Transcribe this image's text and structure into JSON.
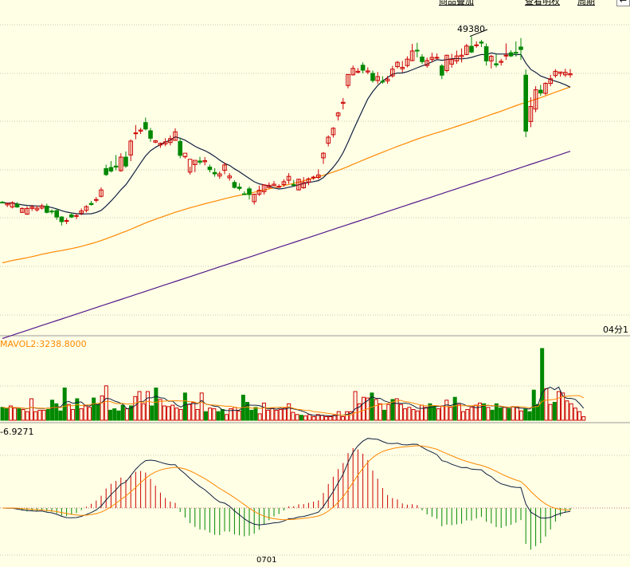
{
  "toolbar": {
    "links": [
      "商品叠加",
      "查看明权",
      "周期"
    ],
    "corner_button": "←"
  },
  "colors": {
    "background": "#ffffe6",
    "up": "#cc0000",
    "down": "#008800",
    "ma_fast": "#102040",
    "ma_mid": "#ff8800",
    "ma_slow": "#551a8b",
    "grid": "#c8c8b4"
  },
  "chart_data": [
    {
      "type": "candlestick",
      "title": "",
      "annotations": [
        {
          "text": "49380",
          "label": "high"
        }
      ],
      "time_label": "04分1",
      "y_min": 41000,
      "y_max": 50400,
      "candles": [
        [
          44725,
          44760,
          44715,
          44700
        ],
        [
          44650,
          44710,
          44690,
          44590
        ],
        [
          44590,
          44750,
          44710,
          44550
        ],
        [
          44665,
          44730,
          44590,
          44570
        ],
        [
          44440,
          44580,
          44550,
          44420
        ],
        [
          44390,
          44610,
          44550,
          44370
        ],
        [
          44550,
          44650,
          44590,
          44480
        ],
        [
          44510,
          44630,
          44560,
          44460
        ],
        [
          44560,
          44680,
          44620,
          44520
        ],
        [
          44615,
          44685,
          44440,
          44410
        ],
        [
          44475,
          44525,
          44470,
          44390
        ],
        [
          44490,
          44520,
          44310,
          44230
        ],
        [
          44310,
          44330,
          44180,
          44070
        ],
        [
          44190,
          44280,
          44210,
          44110
        ],
        [
          44370,
          44430,
          44310,
          44280
        ],
        [
          44335,
          44400,
          44350,
          44250
        ],
        [
          44420,
          44550,
          44480,
          44360
        ],
        [
          44495,
          44640,
          44600,
          44440
        ],
        [
          44690,
          44760,
          44660,
          44630
        ],
        [
          44780,
          44870,
          44800,
          44720
        ],
        [
          44890,
          45140,
          45070,
          44860
        ],
        [
          45670,
          45780,
          45500,
          45460
        ],
        [
          45700,
          45880,
          45600,
          45560
        ],
        [
          45740,
          46050,
          45710,
          45620
        ],
        [
          45610,
          46100,
          45990,
          45580
        ],
        [
          45990,
          46150,
          45740,
          45690
        ],
        [
          46050,
          46490,
          46440,
          45880
        ],
        [
          46660,
          46890,
          46670,
          46490
        ],
        [
          46720,
          46810,
          46750,
          46640
        ],
        [
          46960,
          47100,
          46780,
          46740
        ],
        [
          46730,
          46810,
          46520,
          46420
        ],
        [
          46410,
          46470,
          46450,
          46380
        ],
        [
          46330,
          46400,
          46380,
          46250
        ],
        [
          46360,
          46520,
          46420,
          46300
        ],
        [
          46400,
          46600,
          46510,
          46320
        ],
        [
          46460,
          46800,
          46700,
          46450
        ],
        [
          46430,
          46530,
          46040,
          45960
        ],
        [
          46000,
          46040,
          46100,
          45950
        ],
        [
          45570,
          45720,
          45930,
          45500
        ],
        [
          45780,
          45880,
          45900,
          45570
        ],
        [
          45880,
          46000,
          45850,
          45780
        ],
        [
          45860,
          45990,
          45890,
          45760
        ],
        [
          45710,
          45780,
          45640,
          45560
        ],
        [
          45560,
          45680,
          45520,
          45440
        ],
        [
          45460,
          45590,
          45520,
          45380
        ],
        [
          45620,
          45840,
          45770,
          45510
        ],
        [
          45410,
          45540,
          45460,
          45330
        ],
        [
          45280,
          45340,
          45140,
          45110
        ],
        [
          45150,
          45260,
          45110,
          45050
        ],
        [
          44960,
          45030,
          44950,
          44930
        ],
        [
          45100,
          45160,
          44940,
          44800
        ],
        [
          44740,
          44960,
          44950,
          44660
        ],
        [
          44950,
          45190,
          45060,
          44900
        ],
        [
          45020,
          45230,
          45210,
          44940
        ],
        [
          45140,
          45280,
          45200,
          45110
        ],
        [
          45190,
          45320,
          45230,
          45170
        ],
        [
          45160,
          45230,
          45170,
          45120
        ],
        [
          45220,
          45370,
          45300,
          45160
        ],
        [
          45340,
          45540,
          45450,
          45240
        ],
        [
          45220,
          45350,
          45210,
          45180
        ],
        [
          45070,
          45380,
          45370,
          45060
        ],
        [
          45130,
          45430,
          45280,
          45100
        ],
        [
          45290,
          45420,
          45380,
          45200
        ],
        [
          45410,
          45470,
          45430,
          45350
        ],
        [
          45420,
          45650,
          45490,
          45370
        ],
        [
          45970,
          46130,
          46100,
          45800
        ],
        [
          46380,
          46600,
          46550,
          46290
        ],
        [
          46620,
          46830,
          46800,
          46540
        ],
        [
          47150,
          47260,
          47230,
          47020
        ],
        [
          47500,
          47650,
          47530,
          47330
        ],
        [
          48000,
          48320,
          48310,
          47920
        ],
        [
          48300,
          48560,
          48480,
          48280
        ],
        [
          48370,
          48490,
          48400,
          48340
        ],
        [
          48570,
          48650,
          48430,
          48340
        ],
        [
          48380,
          48510,
          48410,
          48320
        ],
        [
          48340,
          48420,
          48140,
          48080
        ],
        [
          48140,
          48380,
          48250,
          48050
        ],
        [
          48120,
          48260,
          48100,
          48050
        ],
        [
          48130,
          48270,
          48180,
          48050
        ],
        [
          48270,
          48550,
          48460,
          48220
        ],
        [
          48530,
          48690,
          48650,
          48480
        ],
        [
          48470,
          48690,
          48510,
          48370
        ],
        [
          48560,
          48820,
          48740,
          48510
        ],
        [
          48700,
          49170,
          48970,
          48680
        ],
        [
          48990,
          49200,
          48980,
          48790
        ],
        [
          48800,
          48880,
          48670,
          48600
        ],
        [
          48560,
          48780,
          48700,
          48500
        ],
        [
          48730,
          48920,
          48790,
          48650
        ],
        [
          48780,
          48900,
          48790,
          48730
        ],
        [
          48550,
          48600,
          48290,
          48180
        ],
        [
          48420,
          48860,
          48850,
          48370
        ],
        [
          48600,
          48890,
          48730,
          48500
        ],
        [
          48690,
          48980,
          48830,
          48610
        ],
        [
          48810,
          49040,
          48850,
          48650
        ],
        [
          48870,
          49170,
          49110,
          48850
        ],
        [
          49100,
          49380,
          48940,
          48910
        ],
        [
          49120,
          49240,
          49140,
          49060
        ],
        [
          49220,
          49280,
          49190,
          49080
        ],
        [
          49090,
          49180,
          48690,
          48560
        ],
        [
          48690,
          48860,
          48820,
          48480
        ],
        [
          48610,
          48870,
          48580,
          48510
        ],
        [
          48650,
          48750,
          48680,
          48560
        ],
        [
          48850,
          49180,
          48850,
          48720
        ],
        [
          48920,
          48990,
          48830,
          48800
        ],
        [
          48930,
          49240,
          48920,
          48810
        ],
        [
          49080,
          49330,
          49010,
          48720
        ],
        [
          48290,
          48450,
          46720,
          46550
        ],
        [
          46990,
          47670,
          47410,
          46830
        ],
        [
          47340,
          47980,
          47880,
          47250
        ],
        [
          47870,
          48020,
          47790,
          47710
        ],
        [
          47780,
          48090,
          48060,
          47730
        ],
        [
          48060,
          48300,
          48190,
          47980
        ],
        [
          48280,
          48460,
          48400,
          48220
        ],
        [
          48340,
          48380,
          48380,
          48250
        ],
        [
          48300,
          48470,
          48370,
          48240
        ],
        [
          48300,
          48460,
          48330,
          48220
        ]
      ],
      "ma_periods": [
        10,
        30,
        60
      ]
    },
    {
      "type": "bar",
      "title": "MAVOL2:3238.8000",
      "y_max": 3300,
      "volume_pattern": [
        0.18,
        0.16,
        0.2,
        0.17,
        0.16,
        0.15,
        0.12,
        0.3,
        0.12,
        0.14,
        0.14,
        0.15,
        0.28,
        0.23,
        0.13,
        0.45,
        0.22,
        0.15,
        0.3,
        0.16,
        0.2,
        0.18,
        0.31,
        0.22,
        0.34,
        0.48,
        0.14,
        0.16,
        0.13,
        0.21,
        0.16,
        0.2,
        0.33,
        0.4,
        0.23,
        0.4,
        0.2,
        0.45,
        0.29,
        0.2,
        0.19,
        0.21,
        0.17,
        0.15,
        0.38,
        0.22,
        0.25,
        0.15,
        0.38,
        0.12,
        0.17,
        0.16,
        0.12,
        0.15,
        0.08,
        0.16,
        0.18,
        0.13,
        0.35,
        0.25,
        0.14,
        0.18,
        0.09,
        0.24,
        0.14,
        0.17,
        0.14,
        0.15,
        0.17,
        0.23,
        0.11,
        0.08,
        0.07,
        0.06,
        0.08,
        0.05,
        0.08,
        0.07,
        0.05,
        0.05,
        0.07,
        0.12,
        0.05,
        0.12,
        0.12,
        0.4,
        0.23,
        0.32,
        0.31,
        0.38,
        0.29,
        0.23,
        0.14,
        0.22,
        0.29,
        0.3,
        0.22,
        0.16,
        0.18,
        0.15,
        0.13,
        0.21,
        0.18,
        0.23,
        0.2,
        0.16,
        0.2,
        0.28,
        0.18,
        0.32,
        0.22,
        0.12,
        0.15,
        0.18,
        0.21,
        0.24,
        0.23,
        0.18,
        0.14,
        0.23,
        0.17,
        0.18,
        0.16,
        0.19,
        0.18,
        0.13,
        0.16,
        0.12,
        0.42,
        0.22,
        1.0,
        0.44,
        0.22,
        0.25,
        0.4,
        0.38,
        0.27,
        0.23,
        0.17,
        0.12,
        0.05
      ]
    },
    {
      "type": "line",
      "title": "-6.9271",
      "x_tick": "0701",
      "series": [
        "DIF",
        "DEA",
        "MACD"
      ]
    }
  ]
}
